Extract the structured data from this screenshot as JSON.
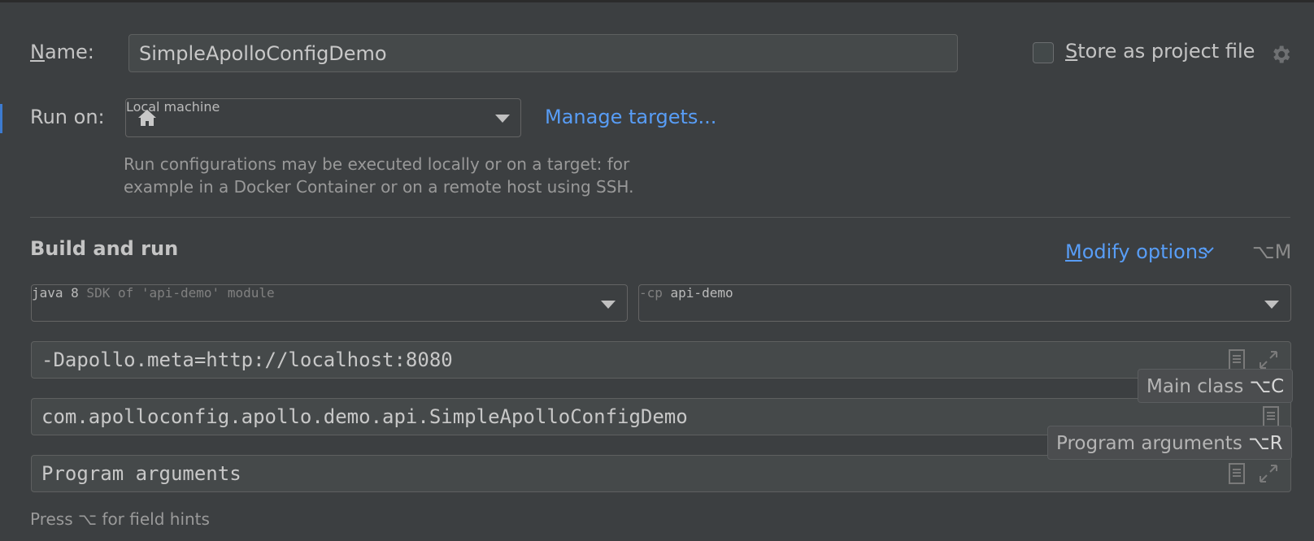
{
  "name": {
    "label_prefix": "N",
    "label_rest": "ame:",
    "value": "SimpleApolloConfigDemo"
  },
  "store": {
    "label_prefix": "S",
    "label_rest": "tore as project file",
    "checked": false
  },
  "run_on": {
    "label": "Run on:",
    "value": "Local machine",
    "manage_link": "Manage targets...",
    "help_line1": "Run configurations may be executed locally or on a target: for",
    "help_line2": "example in a Docker Container or on a remote host using SSH."
  },
  "build_run": {
    "title": "Build and run",
    "modify_prefix": "M",
    "modify_rest": "odify options",
    "modify_shortcut": "⌥M",
    "sdk_bold": "java 8",
    "sdk_dim": " SDK of 'api-demo' module",
    "cp_dim": "-cp ",
    "cp_value": "api-demo",
    "vm_options": "-Dapollo.meta=http://localhost:8080",
    "main_class": "com.apolloconfig.apollo.demo.api.SimpleApolloConfigDemo",
    "program_args_placeholder": "Program arguments"
  },
  "tooltips": {
    "main_class_text": "Main class ",
    "main_class_key": "⌥C",
    "program_args_text": "Program arguments ",
    "program_args_key": "⌥R"
  },
  "footer_hint": "Press ⌥ for field hints",
  "icons": [
    "home-icon",
    "gear-icon",
    "chevron-down-icon",
    "document-icon",
    "expand-icon"
  ],
  "colors": {
    "background": "#3c3f41",
    "link": "#589df6",
    "field_bg": "#45494a"
  }
}
